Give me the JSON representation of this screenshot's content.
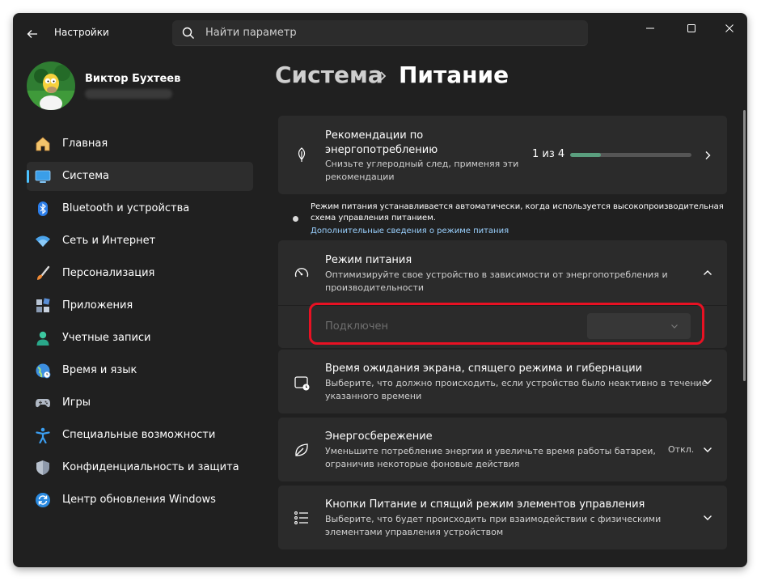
{
  "app": {
    "title": "Настройки"
  },
  "search": {
    "placeholder": "Найти параметр"
  },
  "user": {
    "name": "Виктор Бухтеев"
  },
  "nav": {
    "items": [
      {
        "label": "Главная",
        "icon": "home-icon"
      },
      {
        "label": "Система",
        "icon": "system-icon"
      },
      {
        "label": "Bluetooth и устройства",
        "icon": "bluetooth-icon"
      },
      {
        "label": "Сеть и Интернет",
        "icon": "wifi-icon"
      },
      {
        "label": "Персонализация",
        "icon": "brush-icon"
      },
      {
        "label": "Приложения",
        "icon": "apps-icon"
      },
      {
        "label": "Учетные записи",
        "icon": "person-icon"
      },
      {
        "label": "Время и язык",
        "icon": "globe-icon"
      },
      {
        "label": "Игры",
        "icon": "gamepad-icon"
      },
      {
        "label": "Специальные возможности",
        "icon": "accessibility-icon"
      },
      {
        "label": "Конфиденциальность и защита",
        "icon": "shield-icon"
      },
      {
        "label": "Центр обновления Windows",
        "icon": "update-icon"
      }
    ]
  },
  "breadcrumb": {
    "parent": "Система",
    "current": "Питание"
  },
  "recommendations": {
    "title_line1": "Рекомендации по",
    "title_line2": "энергопотреблению",
    "desc_line1": "Снизьте углеродный след, применяя эти",
    "desc_line2": "рекомендации",
    "count": "1 из 4",
    "progress": 0.25
  },
  "info": {
    "line1": "Режим питания устанавливается автоматически, когда используется высокопроизводительная",
    "line2": "схема управления питанием.",
    "link": "Дополнительные сведения о режиме питания"
  },
  "power_mode": {
    "title": "Режим питания",
    "desc_line1": "Оптимизируйте свое устройство в зависимости от энергопотребления и",
    "desc_line2": "производительности",
    "row_label": "Подключен"
  },
  "screen_timeout": {
    "title": "Время ожидания экрана, спящего режима и гибернации",
    "desc_line1": "Выберите, что должно происходить, если устройство было неактивно в течение",
    "desc_line2": "указанного времени"
  },
  "energy_saver": {
    "title": "Энергосбережение",
    "desc_line1": "Уменьшите потребление энергии и увеличьте время работы батареи,",
    "desc_line2": "ограничив некоторые фоновые действия",
    "status": "Откл."
  },
  "power_buttons": {
    "title": "Кнопки Питание и спящий режим элементов управления",
    "desc_line1": "Выберите, что будет происходить при взаимодействии с физическими",
    "desc_line2": "элементами управления устройством"
  },
  "colors": {
    "accent": "#4cc2ff",
    "progress": "#5a9e7e",
    "highlight": "#e81123",
    "window_bg": "#202020",
    "card_bg": "#2b2b2b"
  }
}
